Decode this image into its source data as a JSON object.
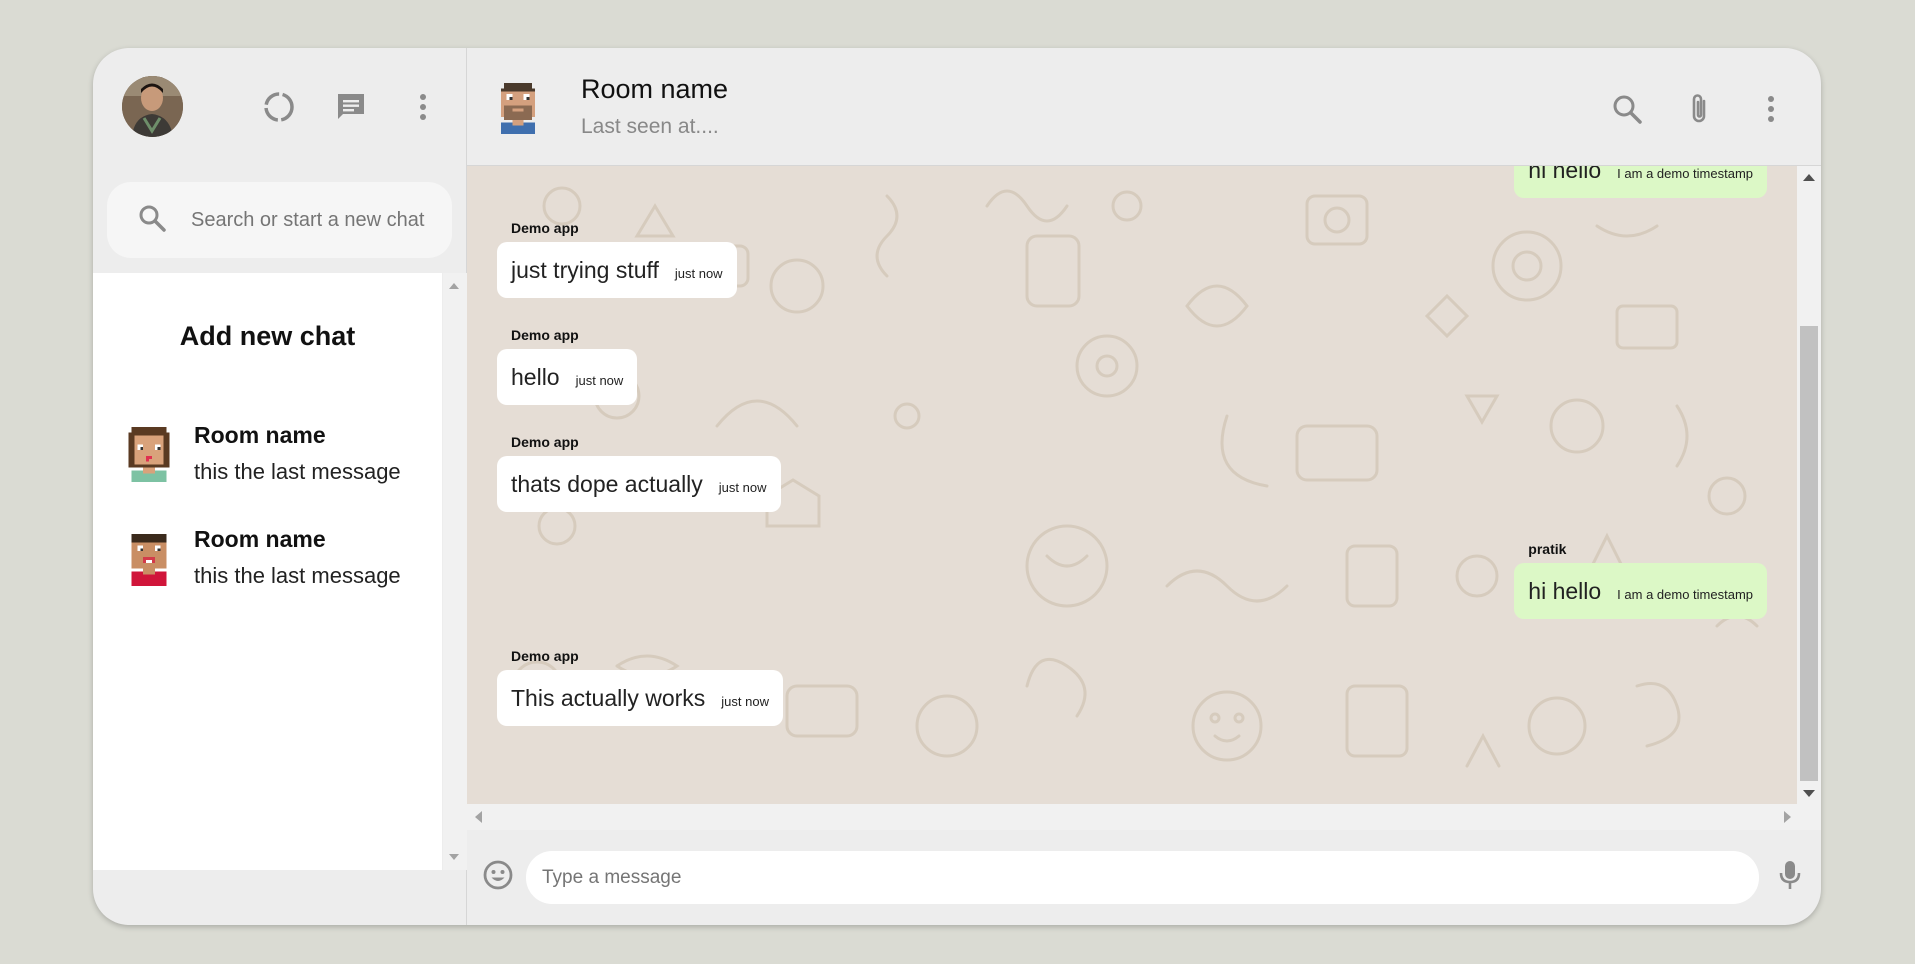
{
  "sidebar": {
    "search_placeholder": "Search or start a new chat",
    "add_new_chat": "Add new chat",
    "chats": [
      {
        "name": "Room name",
        "last_message": "this the last message"
      },
      {
        "name": "Room name",
        "last_message": "this the last message"
      }
    ]
  },
  "chat": {
    "room_name": "Room name",
    "last_seen": "Last seen at....",
    "messages": [
      {
        "sender": "",
        "text": "hi hello",
        "timestamp": "I am a demo timestamp",
        "sent": true
      },
      {
        "sender": "Demo app",
        "text": "just trying stuff",
        "timestamp": "just now",
        "sent": false
      },
      {
        "sender": "Demo app",
        "text": "hello",
        "timestamp": "just now",
        "sent": false
      },
      {
        "sender": "Demo app",
        "text": "thats dope actually",
        "timestamp": "just now",
        "sent": false
      },
      {
        "sender": "pratik",
        "text": "hi hello",
        "timestamp": "I am a demo timestamp",
        "sent": true
      },
      {
        "sender": "Demo app",
        "text": "This actually works",
        "timestamp": "just now",
        "sent": false
      }
    ],
    "input_placeholder": "Type a message"
  },
  "icons": {
    "status": "status-icon",
    "new_chat": "chat-icon",
    "menu": "more-vert-icon",
    "search": "search-icon",
    "attach": "attach-icon",
    "emoji": "emoji-icon",
    "mic": "mic-icon"
  },
  "colors": {
    "background": "#dadbd3",
    "panel": "#ededed",
    "chat_bg": "#e5ddd5",
    "sent_bubble": "#dcf8c6",
    "received_bubble": "#ffffff",
    "icon": "#8a8a8a"
  }
}
